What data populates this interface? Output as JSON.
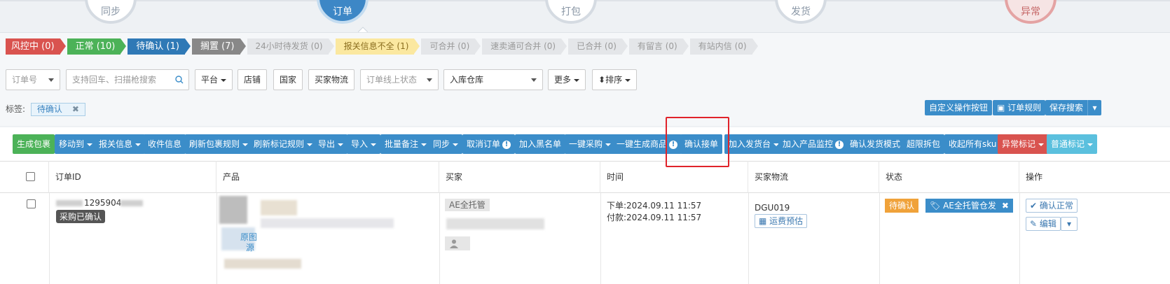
{
  "steps": [
    {
      "label": "同步"
    },
    {
      "label": "订单"
    },
    {
      "label": "打包"
    },
    {
      "label": "发货"
    },
    {
      "label": "异常"
    }
  ],
  "tabs": [
    {
      "label": "风控中 (0)",
      "color": "#d9534f"
    },
    {
      "label": "正常 (10)",
      "color": "#4cb258"
    },
    {
      "label": "待确认 (1)",
      "color": "#2f79b6"
    },
    {
      "label": "搁置 (7)",
      "color": "#888888"
    },
    {
      "label": "24小时待发货 (0)"
    },
    {
      "label": "报关信息不全 (1)"
    },
    {
      "label": "可合并 (0)"
    },
    {
      "label": "速卖通可合并 (0)"
    },
    {
      "label": "已合并 (0)"
    },
    {
      "label": "有留言 (0)"
    },
    {
      "label": "有站内信 (0)"
    }
  ],
  "filters": {
    "order_no": "订单号",
    "search_placeholder": "支持回车、扫描枪搜索",
    "platform": "平台",
    "shop": "店铺",
    "country": "国家",
    "buyer_logistics": "买家物流",
    "online_status": "订单线上状态",
    "warehouse": "入库仓库",
    "more": "更多",
    "sort": "排序"
  },
  "tag_label": "标签:",
  "active_tag": "待确认",
  "right_buttons": {
    "custom": "自定义操作按钮",
    "rules": "订单规则",
    "save_search": "保存搜索"
  },
  "toolbar": [
    "生成包裹",
    "移动到",
    "报关信息",
    "收件信息",
    "刷新包裹规则",
    "刷新标记规则",
    "导出",
    "导入",
    "批量备注",
    "同步",
    "取消订单",
    "加入黑名单",
    "一键采购",
    "一键生成商品",
    "确认接单",
    "加入发货台",
    "加入产品监控",
    "确认发货模式",
    "超限拆包",
    "收起所有sku",
    "异常标记",
    "普通标记"
  ],
  "table": {
    "headers": [
      "订单ID",
      "产品",
      "买家",
      "时间",
      "买家物流",
      "状态",
      "操作"
    ],
    "row": {
      "order_id": "1295904",
      "purchase_badge": "采购已确认",
      "product_link1": "原图",
      "product_link2": "源",
      "buyer_tag": "AE全托管",
      "time_order": "下单:2024.09.11 11:57",
      "time_paid": "付款:2024.09.11 11:57",
      "logistics": "DGU019",
      "freight_btn": "运费预估",
      "status_pending": "待确认",
      "status_tag": "AE全托管仓发",
      "confirm_btn": "确认正常",
      "edit_btn": "编辑"
    }
  }
}
